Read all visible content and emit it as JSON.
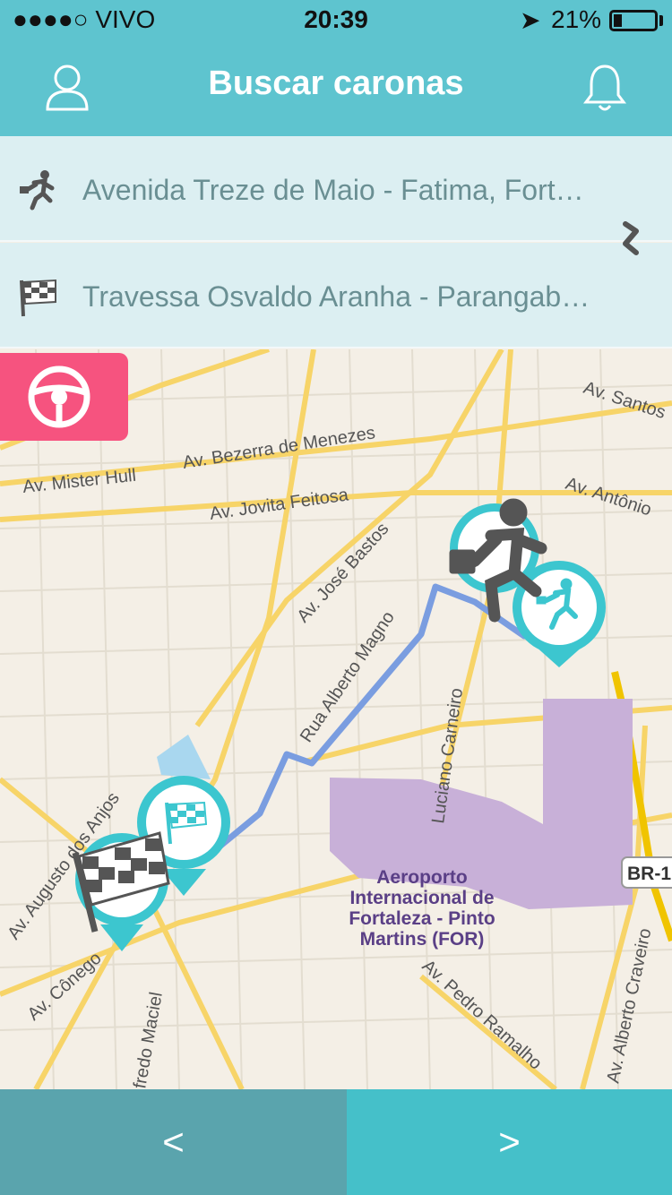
{
  "status_bar": {
    "carrier": "●●●●○ VIVO",
    "time": "20:39",
    "battery": "21%",
    "battery_level": 0.21
  },
  "header": {
    "title": "Buscar caronas"
  },
  "route": {
    "origin": "Avenida Treze de Maio - Fatima, Fort…",
    "destination": "Travessa Osvaldo Aranha - Parangab…"
  },
  "map": {
    "streets": [
      "Av. Bezerra de Menezes",
      "Av. Mister Hull",
      "Av. Jovita Feitosa",
      "Av. José Bastos",
      "Av. Santos",
      "Av. Antônio",
      "Luciano Carneiro",
      "Av. Augusto dos Anjos",
      "Av. Cônego",
      "fredo Maciel",
      "Av. Pedro Ramalho",
      "Av. Alberto Craveiro",
      "Rua Alberto Magno"
    ],
    "highway_label": "BR-1",
    "airport": [
      "Aeroporto",
      "Internacional de",
      "Fortaleza - Pinto",
      "Martins (FOR)"
    ],
    "colors": {
      "route": "#7a9de0",
      "airport": "#c8b0d8",
      "road": "#f7d468",
      "highway": "#f0c400",
      "pin": "#3cc6cf"
    }
  },
  "footer": {
    "prev_label": "<",
    "next_label": ">"
  }
}
